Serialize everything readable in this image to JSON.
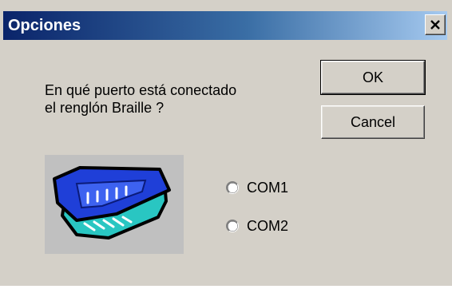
{
  "window": {
    "title": "Opciones",
    "close_glyph": "✕"
  },
  "prompt": {
    "line1": "En qué puerto está conectado",
    "line2": "el renglón Braille ?"
  },
  "buttons": {
    "ok_label": "OK",
    "cancel_label": "Cancel"
  },
  "ports": [
    {
      "label": "COM1",
      "selected": false
    },
    {
      "label": "COM2",
      "selected": false
    }
  ],
  "image": {
    "icon": "serial-connector-icon"
  },
  "colors": {
    "face": "#d4d0c8",
    "title_start": "#0a246a",
    "title_end": "#a6caf0",
    "connector_blue": "#1f3fd8",
    "connector_cyan": "#29c6c2"
  }
}
